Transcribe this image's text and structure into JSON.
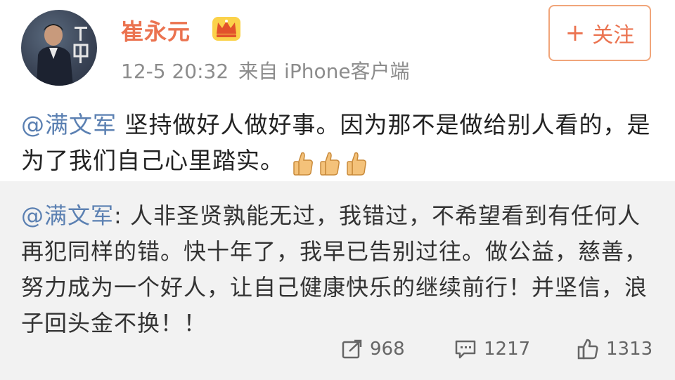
{
  "header": {
    "username": "崔永元",
    "time": "12-5 20:32",
    "source": "来自 iPhone客户端",
    "follow_label": "关注",
    "colors": {
      "username": "#eb7350",
      "accent": "#f0a51c"
    }
  },
  "post": {
    "mention": "@满文军",
    "text": " 坚持做好人做好事。因为那不是做给别人看的，是为了我们自己心里踏实。"
  },
  "repost": {
    "mention": "@满文军",
    "text": ": 人非圣贤孰能无过，我错过，不希望看到有任何人再犯同样的错。快十年了，我早已告别过往。做公益，慈善，努力成为一个好人，让自己健康快乐的继续前行！并坚信，浪子回头金不换！！"
  },
  "actions": {
    "repost_count": "968",
    "comment_count": "1217",
    "like_count": "1313"
  },
  "icons": [
    "avatar",
    "crown-icon",
    "verified-badge-icon",
    "plus-icon",
    "thumbs-up-icon",
    "repost-icon",
    "comment-icon",
    "like-icon"
  ]
}
